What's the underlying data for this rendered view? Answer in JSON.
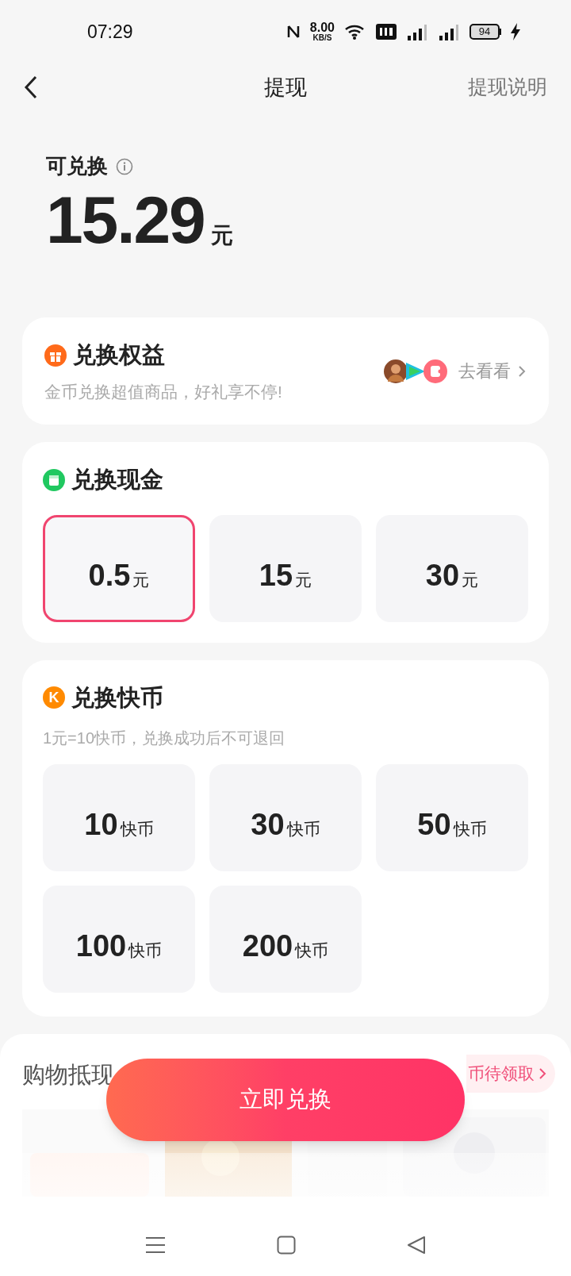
{
  "status_bar": {
    "time": "07:29",
    "net_speed": "8.00",
    "net_unit": "KB/S",
    "battery": "94"
  },
  "header": {
    "title": "提现",
    "action": "提现说明"
  },
  "balance": {
    "label": "可兑换",
    "amount": "15.29",
    "unit": "元"
  },
  "benefits": {
    "title": "兑换权益",
    "subtitle": "金币兑换超值商品，好礼享不停!",
    "link": "去看看"
  },
  "cash": {
    "title": "兑换现金",
    "options": [
      {
        "value": "0.5",
        "unit": "元",
        "selected": true
      },
      {
        "value": "15",
        "unit": "元",
        "selected": false
      },
      {
        "value": "30",
        "unit": "元",
        "selected": false
      }
    ]
  },
  "coins": {
    "title": "兑换快币",
    "icon_letter": "K",
    "note": "1元=10快币，兑换成功后不可退回",
    "options": [
      {
        "value": "10",
        "unit": "快币",
        "selected": false
      },
      {
        "value": "30",
        "unit": "快币",
        "selected": false
      },
      {
        "value": "50",
        "unit": "快币",
        "selected": false
      },
      {
        "value": "100",
        "unit": "快币",
        "selected": false
      },
      {
        "value": "200",
        "unit": "快币",
        "selected": false
      }
    ]
  },
  "shopping": {
    "title": "购物抵现",
    "chip": "币待领取"
  },
  "primary_button": "立即兑换"
}
